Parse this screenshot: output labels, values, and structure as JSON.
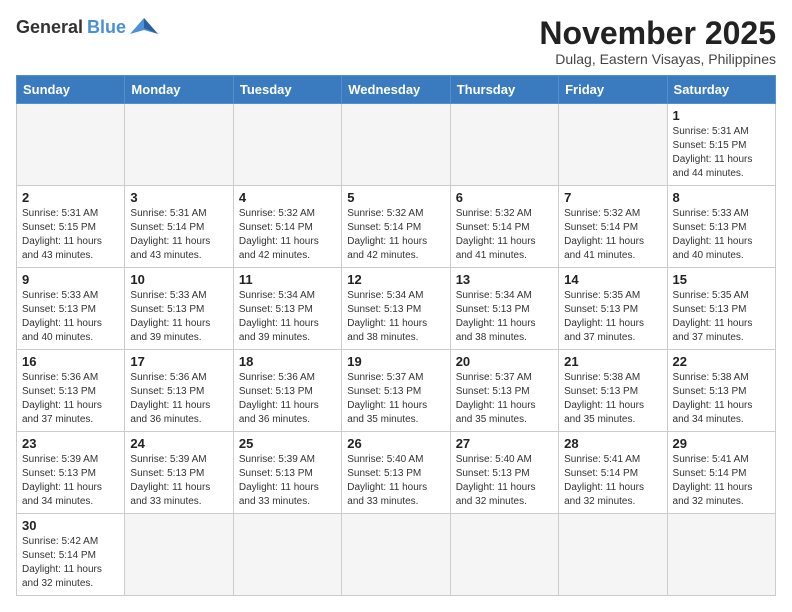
{
  "header": {
    "logo_general": "General",
    "logo_blue": "Blue",
    "month_title": "November 2025",
    "location": "Dulag, Eastern Visayas, Philippines"
  },
  "weekdays": [
    "Sunday",
    "Monday",
    "Tuesday",
    "Wednesday",
    "Thursday",
    "Friday",
    "Saturday"
  ],
  "weeks": [
    [
      {
        "day": "",
        "sunrise": "",
        "sunset": "",
        "daylight": ""
      },
      {
        "day": "",
        "sunrise": "",
        "sunset": "",
        "daylight": ""
      },
      {
        "day": "",
        "sunrise": "",
        "sunset": "",
        "daylight": ""
      },
      {
        "day": "",
        "sunrise": "",
        "sunset": "",
        "daylight": ""
      },
      {
        "day": "",
        "sunrise": "",
        "sunset": "",
        "daylight": ""
      },
      {
        "day": "",
        "sunrise": "",
        "sunset": "",
        "daylight": ""
      },
      {
        "day": "1",
        "sunrise": "Sunrise: 5:31 AM",
        "sunset": "Sunset: 5:15 PM",
        "daylight": "Daylight: 11 hours and 44 minutes."
      }
    ],
    [
      {
        "day": "2",
        "sunrise": "Sunrise: 5:31 AM",
        "sunset": "Sunset: 5:15 PM",
        "daylight": "Daylight: 11 hours and 43 minutes."
      },
      {
        "day": "3",
        "sunrise": "Sunrise: 5:31 AM",
        "sunset": "Sunset: 5:14 PM",
        "daylight": "Daylight: 11 hours and 43 minutes."
      },
      {
        "day": "4",
        "sunrise": "Sunrise: 5:32 AM",
        "sunset": "Sunset: 5:14 PM",
        "daylight": "Daylight: 11 hours and 42 minutes."
      },
      {
        "day": "5",
        "sunrise": "Sunrise: 5:32 AM",
        "sunset": "Sunset: 5:14 PM",
        "daylight": "Daylight: 11 hours and 42 minutes."
      },
      {
        "day": "6",
        "sunrise": "Sunrise: 5:32 AM",
        "sunset": "Sunset: 5:14 PM",
        "daylight": "Daylight: 11 hours and 41 minutes."
      },
      {
        "day": "7",
        "sunrise": "Sunrise: 5:32 AM",
        "sunset": "Sunset: 5:14 PM",
        "daylight": "Daylight: 11 hours and 41 minutes."
      },
      {
        "day": "8",
        "sunrise": "Sunrise: 5:33 AM",
        "sunset": "Sunset: 5:13 PM",
        "daylight": "Daylight: 11 hours and 40 minutes."
      }
    ],
    [
      {
        "day": "9",
        "sunrise": "Sunrise: 5:33 AM",
        "sunset": "Sunset: 5:13 PM",
        "daylight": "Daylight: 11 hours and 40 minutes."
      },
      {
        "day": "10",
        "sunrise": "Sunrise: 5:33 AM",
        "sunset": "Sunset: 5:13 PM",
        "daylight": "Daylight: 11 hours and 39 minutes."
      },
      {
        "day": "11",
        "sunrise": "Sunrise: 5:34 AM",
        "sunset": "Sunset: 5:13 PM",
        "daylight": "Daylight: 11 hours and 39 minutes."
      },
      {
        "day": "12",
        "sunrise": "Sunrise: 5:34 AM",
        "sunset": "Sunset: 5:13 PM",
        "daylight": "Daylight: 11 hours and 38 minutes."
      },
      {
        "day": "13",
        "sunrise": "Sunrise: 5:34 AM",
        "sunset": "Sunset: 5:13 PM",
        "daylight": "Daylight: 11 hours and 38 minutes."
      },
      {
        "day": "14",
        "sunrise": "Sunrise: 5:35 AM",
        "sunset": "Sunset: 5:13 PM",
        "daylight": "Daylight: 11 hours and 37 minutes."
      },
      {
        "day": "15",
        "sunrise": "Sunrise: 5:35 AM",
        "sunset": "Sunset: 5:13 PM",
        "daylight": "Daylight: 11 hours and 37 minutes."
      }
    ],
    [
      {
        "day": "16",
        "sunrise": "Sunrise: 5:36 AM",
        "sunset": "Sunset: 5:13 PM",
        "daylight": "Daylight: 11 hours and 37 minutes."
      },
      {
        "day": "17",
        "sunrise": "Sunrise: 5:36 AM",
        "sunset": "Sunset: 5:13 PM",
        "daylight": "Daylight: 11 hours and 36 minutes."
      },
      {
        "day": "18",
        "sunrise": "Sunrise: 5:36 AM",
        "sunset": "Sunset: 5:13 PM",
        "daylight": "Daylight: 11 hours and 36 minutes."
      },
      {
        "day": "19",
        "sunrise": "Sunrise: 5:37 AM",
        "sunset": "Sunset: 5:13 PM",
        "daylight": "Daylight: 11 hours and 35 minutes."
      },
      {
        "day": "20",
        "sunrise": "Sunrise: 5:37 AM",
        "sunset": "Sunset: 5:13 PM",
        "daylight": "Daylight: 11 hours and 35 minutes."
      },
      {
        "day": "21",
        "sunrise": "Sunrise: 5:38 AM",
        "sunset": "Sunset: 5:13 PM",
        "daylight": "Daylight: 11 hours and 35 minutes."
      },
      {
        "day": "22",
        "sunrise": "Sunrise: 5:38 AM",
        "sunset": "Sunset: 5:13 PM",
        "daylight": "Daylight: 11 hours and 34 minutes."
      }
    ],
    [
      {
        "day": "23",
        "sunrise": "Sunrise: 5:39 AM",
        "sunset": "Sunset: 5:13 PM",
        "daylight": "Daylight: 11 hours and 34 minutes."
      },
      {
        "day": "24",
        "sunrise": "Sunrise: 5:39 AM",
        "sunset": "Sunset: 5:13 PM",
        "daylight": "Daylight: 11 hours and 33 minutes."
      },
      {
        "day": "25",
        "sunrise": "Sunrise: 5:39 AM",
        "sunset": "Sunset: 5:13 PM",
        "daylight": "Daylight: 11 hours and 33 minutes."
      },
      {
        "day": "26",
        "sunrise": "Sunrise: 5:40 AM",
        "sunset": "Sunset: 5:13 PM",
        "daylight": "Daylight: 11 hours and 33 minutes."
      },
      {
        "day": "27",
        "sunrise": "Sunrise: 5:40 AM",
        "sunset": "Sunset: 5:13 PM",
        "daylight": "Daylight: 11 hours and 32 minutes."
      },
      {
        "day": "28",
        "sunrise": "Sunrise: 5:41 AM",
        "sunset": "Sunset: 5:14 PM",
        "daylight": "Daylight: 11 hours and 32 minutes."
      },
      {
        "day": "29",
        "sunrise": "Sunrise: 5:41 AM",
        "sunset": "Sunset: 5:14 PM",
        "daylight": "Daylight: 11 hours and 32 minutes."
      }
    ],
    [
      {
        "day": "30",
        "sunrise": "Sunrise: 5:42 AM",
        "sunset": "Sunset: 5:14 PM",
        "daylight": "Daylight: 11 hours and 32 minutes."
      },
      {
        "day": "",
        "sunrise": "",
        "sunset": "",
        "daylight": ""
      },
      {
        "day": "",
        "sunrise": "",
        "sunset": "",
        "daylight": ""
      },
      {
        "day": "",
        "sunrise": "",
        "sunset": "",
        "daylight": ""
      },
      {
        "day": "",
        "sunrise": "",
        "sunset": "",
        "daylight": ""
      },
      {
        "day": "",
        "sunrise": "",
        "sunset": "",
        "daylight": ""
      },
      {
        "day": "",
        "sunrise": "",
        "sunset": "",
        "daylight": ""
      }
    ]
  ]
}
